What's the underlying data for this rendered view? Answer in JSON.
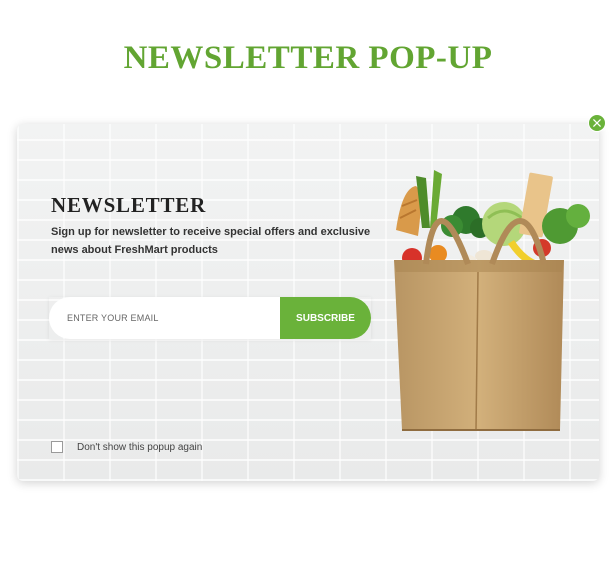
{
  "page": {
    "heading": "NEWSLETTER POP-UP"
  },
  "popup": {
    "title": "NEWSLETTER",
    "description": "Sign up for newsletter to receive special offers and exclusive news about FreshMart products",
    "email_placeholder": "ENTER YOUR EMAIL",
    "email_value": "",
    "subscribe_label": "SUBSCRIBE",
    "dont_show_label": "Don't show this popup again",
    "dont_show_checked": false,
    "close_icon": "close-icon",
    "illustration": "grocery-bag-illustration"
  },
  "colors": {
    "accent": "#6ab23a",
    "heading": "#62a532",
    "title": "#222222",
    "background": "#ffffff",
    "popup_bg": "#eeefef"
  }
}
